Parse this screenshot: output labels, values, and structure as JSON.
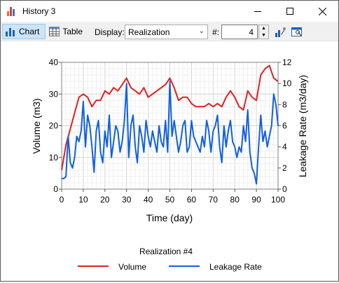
{
  "window": {
    "title": "History 3"
  },
  "toolbar": {
    "chart_label": "Chart",
    "table_label": "Table",
    "display_label": "Display:",
    "display_value": "Realization",
    "number_label": "#:",
    "number_value": "4"
  },
  "chart_data": {
    "type": "line",
    "title": "Realization #4",
    "xlabel": "Time (day)",
    "ylabel": "Volume (m3)",
    "y2label": "Leakage Rate (m3/day)",
    "xlim": [
      0,
      100
    ],
    "ylim": [
      0,
      40
    ],
    "y2lim": [
      0,
      12
    ],
    "x_ticks": [
      "0",
      "10",
      "20",
      "30",
      "40",
      "50",
      "60",
      "70",
      "80",
      "90",
      "100"
    ],
    "y_ticks": [
      "0",
      "10",
      "20",
      "30",
      "40"
    ],
    "y2_ticks": [
      "0",
      "2",
      "4",
      "6",
      "8",
      "10",
      "12"
    ],
    "grid": true,
    "legend_position": "bottom",
    "colors": {
      "volume": "#e02020",
      "leakage": "#1060e0"
    },
    "series": [
      {
        "name": "Volume",
        "axis": "left",
        "x": [
          0,
          2,
          4,
          6,
          8,
          10,
          12,
          14,
          16,
          18,
          20,
          22,
          24,
          26,
          28,
          30,
          32,
          34,
          36,
          38,
          40,
          42,
          44,
          46,
          48,
          50,
          52,
          54,
          56,
          58,
          60,
          62,
          64,
          66,
          68,
          70,
          72,
          74,
          76,
          78,
          80,
          82,
          84,
          86,
          88,
          90,
          92,
          94,
          96,
          98,
          100
        ],
        "values": [
          6,
          14,
          19,
          24,
          29,
          30,
          29,
          26,
          28,
          28,
          31,
          30,
          32,
          31,
          33,
          35,
          32,
          31,
          30,
          32,
          29,
          30,
          31,
          32,
          33,
          35,
          32,
          28,
          29,
          29,
          27,
          26,
          26,
          26,
          27,
          26,
          27,
          26,
          29,
          31,
          29,
          26,
          25,
          31,
          29,
          28,
          36,
          38,
          39,
          35,
          34
        ]
      },
      {
        "name": "Leakage Rate",
        "axis": "right",
        "x": [
          0,
          1,
          2,
          3,
          4,
          5,
          6,
          7,
          8,
          9,
          10,
          11,
          12,
          13,
          14,
          15,
          16,
          17,
          18,
          19,
          20,
          21,
          22,
          23,
          24,
          25,
          26,
          27,
          28,
          29,
          30,
          31,
          32,
          33,
          34,
          35,
          36,
          37,
          38,
          39,
          40,
          41,
          42,
          43,
          44,
          45,
          46,
          47,
          48,
          49,
          50,
          51,
          52,
          53,
          54,
          55,
          56,
          57,
          58,
          59,
          60,
          61,
          62,
          63,
          64,
          65,
          66,
          67,
          68,
          69,
          70,
          71,
          72,
          73,
          74,
          75,
          76,
          77,
          78,
          79,
          80,
          81,
          82,
          83,
          84,
          85,
          86,
          87,
          88,
          89,
          90,
          91,
          92,
          93,
          94,
          95,
          96,
          97,
          98,
          99,
          100
        ],
        "values": [
          1.0,
          1.0,
          1.2,
          5.0,
          2.5,
          2.0,
          3.0,
          5.0,
          4.5,
          5.5,
          8.3,
          4.0,
          7.0,
          6.0,
          4.0,
          1.6,
          5.5,
          6.5,
          3.5,
          2.5,
          5.5,
          4.0,
          7.0,
          3.0,
          4.5,
          6.0,
          5.5,
          3.5,
          4.5,
          6.5,
          10.0,
          3.0,
          6.0,
          7.0,
          4.0,
          2.5,
          6.0,
          5.0,
          3.5,
          6.5,
          5.0,
          4.0,
          5.5,
          4.5,
          3.5,
          6.0,
          4.5,
          4.0,
          6.5,
          3.5,
          10.2,
          5.0,
          6.5,
          5.0,
          3.5,
          4.5,
          6.0,
          6.5,
          3.5,
          4.0,
          6.5,
          5.0,
          4.5,
          4.0,
          3.5,
          5.0,
          4.0,
          6.5,
          5.5,
          3.5,
          5.5,
          6.0,
          7.0,
          4.0,
          2.5,
          6.0,
          4.0,
          5.5,
          6.5,
          4.5,
          4.0,
          3.0,
          4.0,
          3.5,
          6.0,
          4.5,
          7.5,
          3.5,
          2.0,
          1.5,
          0.5,
          4.0,
          7.0,
          4.5,
          5.5,
          4.0,
          5.0,
          6.0,
          9.0,
          8.0,
          6.0
        ]
      }
    ]
  }
}
